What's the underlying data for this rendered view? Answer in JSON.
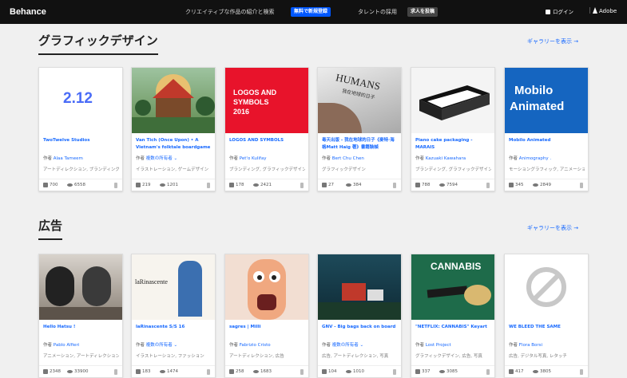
{
  "topbar": {
    "logo": "Behance",
    "tagline": "クリエイティブな作品の紹介と検索",
    "signup": "無料で新規登録",
    "talent": "タレントの採用",
    "post": "求人を投稿",
    "login": "ログイン",
    "adobe": "Adobe"
  },
  "sections": [
    {
      "title": "グラフィックデザイン",
      "gallery_link": "ギャラリーを表示 →",
      "cards": [
        {
          "title": "TwoTwelve Studios",
          "author_label": "作者",
          "author": "Alaa Tameem",
          "fields": "アートディレクション, ブランディング",
          "appreciations": "700",
          "views": "6558"
        },
        {
          "title": "Van Tich (Once Upon) • A Vietnam's folktale boardgame",
          "author_label": "作者",
          "author": "複数の所有者 ⌄",
          "fields": "イラストレーション, ゲームデザイン",
          "appreciations": "219",
          "views": "1201"
        },
        {
          "title": "LOGOS AND SYMBOLS",
          "author_label": "作者",
          "author": "Pet'o Kulifay",
          "fields": "ブランディング, グラフィックデザイン",
          "appreciations": "178",
          "views": "2421"
        },
        {
          "title": "毒天出版 - 我在地球的日子《麥特·海格Matt Haig 著》書籍裝幀",
          "author_label": "作者",
          "author": "Bert Chu Chen",
          "fields": "グラフィックデザイン",
          "appreciations": "27",
          "views": "384"
        },
        {
          "title": "Piano cake packaging - MARAIS",
          "author_label": "作者",
          "author": "Kazuaki Kawahara",
          "fields": "ブランディング, グラフィックデザイン",
          "appreciations": "788",
          "views": "7594"
        },
        {
          "title": "Mobilo Animated",
          "author_label": "作者",
          "author": "Animography .",
          "fields": "モーショングラフィック, アニメーション",
          "appreciations": "345",
          "views": "2849"
        }
      ]
    },
    {
      "title": "広告",
      "gallery_link": "ギャラリーを表示 →",
      "cards": [
        {
          "title": "Hello Hatsu !",
          "author_label": "作者",
          "author": "Pablo Alfieri",
          "fields": "アニメーション, アートディレクション",
          "appreciations": "2348",
          "views": "33900"
        },
        {
          "title": "laRinascente S/S 16",
          "author_label": "作者",
          "author": "複数の所有者 ⌄",
          "fields": "イラストレーション, ファッション",
          "appreciations": "183",
          "views": "1474"
        },
        {
          "title": "sagres | Milli",
          "author_label": "作者",
          "author": "Fabrizio Cristo",
          "fields": "アートディレクション, 広告",
          "appreciations": "258",
          "views": "1683"
        },
        {
          "title": "GNV - Big bags back on board",
          "author_label": "作者",
          "author": "複数の所有者 ⌄",
          "fields": "広告, アートディレクション, 写真",
          "appreciations": "104",
          "views": "1010"
        },
        {
          "title": "\"NETFLIX: CANNABIS\" Keyart",
          "author_label": "作者",
          "author": "Lost Project",
          "fields": "グラフィックデザイン, 広告, 写真",
          "appreciations": "337",
          "views": "3085"
        },
        {
          "title": "WE BLEED THE SAME",
          "author_label": "作者",
          "author": "Flora Borsi",
          "fields": "広告, デジタル写真, レタッチ",
          "appreciations": "417",
          "views": "3805"
        }
      ]
    }
  ],
  "thumb_text": {
    "twotwelve": "2.12",
    "logos1": "LOGOS AND",
    "logos2": "SYMBOLS",
    "logos3": "2016",
    "humans": "HUMANS",
    "humans_sub": "我在地球的日子",
    "mobilo1": "Mobilo",
    "mobilo2": "Animated",
    "rinascente": "laRinascente",
    "cannabis": "CANNABIS"
  }
}
